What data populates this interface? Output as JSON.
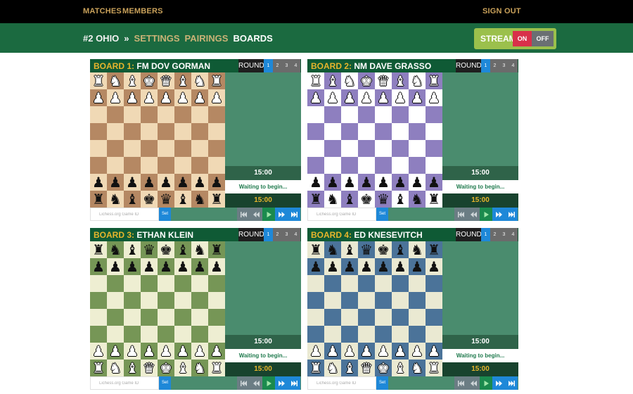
{
  "nav": {
    "matches": "MATCHES",
    "members": "MEMBERS",
    "sign_out": "SIGN OUT"
  },
  "breadcrumb": {
    "team": "#2 OHIO",
    "separator": "»",
    "settings": "SETTINGS",
    "pairings": "PAIRINGS",
    "boards": "BOARDS"
  },
  "stream": {
    "label": "STREAM",
    "on": "ON",
    "off": "OFF"
  },
  "round_label": "ROUND",
  "round_options": [
    "1",
    "2",
    "3",
    "4"
  ],
  "colors": {
    "accent_gold": "#e7b52c",
    "header_green": "#1b6a40",
    "active_blue": "#1e88d8",
    "stream_on_red": "#d8304a"
  },
  "boards": [
    {
      "number_label": "BOARD 1:",
      "player": "FM DOV GORMAN",
      "active_round": "1",
      "light_color": "#f0d9b5",
      "dark_color": "#b58863",
      "top_clock": "15:00",
      "status": "Waiting to begin...",
      "bottom_clock": "15:00",
      "placeholder": "Lichess.org Game ID",
      "set_label": "Set",
      "position": [
        "RNBKQBNR",
        "PPPPPPPP",
        "........",
        "........",
        "........",
        "........",
        "pppppppp",
        "rnbkqbnr"
      ]
    },
    {
      "number_label": "BOARD 2:",
      "player": "NM DAVE GRASSO",
      "active_round": "1",
      "light_color": "#ffffff",
      "dark_color": "#8e7fbf",
      "top_clock": "15:00",
      "status": "Waiting to begin...",
      "bottom_clock": "15:00",
      "placeholder": "Lichess.org Game ID",
      "set_label": "Set",
      "position": [
        "RBNKQBNR",
        "PPPPPPPP",
        "........",
        "........",
        "........",
        "........",
        "pppppppp",
        "rnbkqbnr"
      ]
    },
    {
      "number_label": "BOARD 3:",
      "player": "ETHAN KLEIN",
      "active_round": "1",
      "light_color": "#eeeed2",
      "dark_color": "#769656",
      "top_clock": "15:00",
      "status": "Waiting to begin...",
      "bottom_clock": "15:00",
      "placeholder": "Lichess.org Game ID",
      "set_label": "Set",
      "position": [
        "rnbqkbnr",
        "pppppppp",
        "........",
        "........",
        "........",
        "........",
        "PPPPPPPP",
        "RNBQKBNR"
      ]
    },
    {
      "number_label": "BOARD 4:",
      "player": "ED KNESEVITCH",
      "active_round": "1",
      "light_color": "#eae9d2",
      "dark_color": "#4b7399",
      "top_clock": "15:00",
      "status": "Waiting to begin...",
      "bottom_clock": "15:00",
      "placeholder": "Lichess.org Game ID",
      "set_label": "Set",
      "position": [
        "rnbqkbnr",
        "pppppppp",
        "........",
        "........",
        "........",
        "........",
        "PPPPPPPP",
        "RNBQKBNR"
      ]
    }
  ],
  "controls": [
    {
      "name": "first-move-icon",
      "style": "grey"
    },
    {
      "name": "prev-move-icon",
      "style": "grey"
    },
    {
      "name": "play-icon",
      "style": "green"
    },
    {
      "name": "next-move-icon",
      "style": "blue"
    },
    {
      "name": "last-move-icon",
      "style": "blue"
    }
  ]
}
